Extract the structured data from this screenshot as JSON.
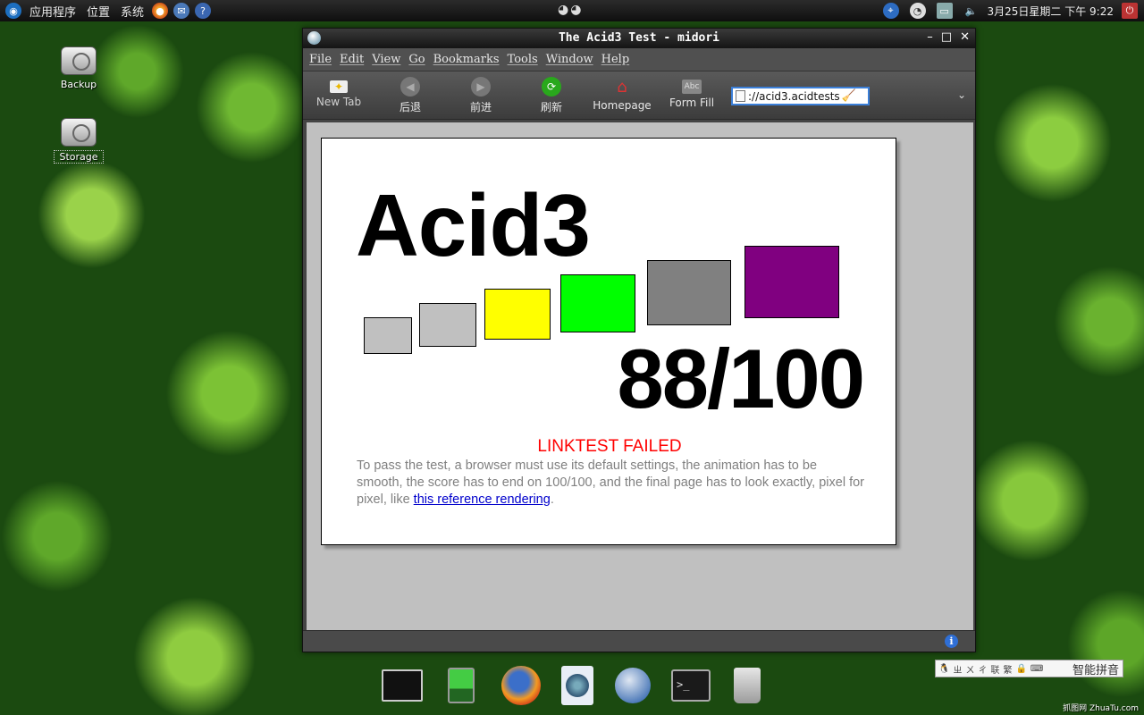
{
  "top_panel": {
    "applications": "应用程序",
    "places": "位置",
    "system": "系统",
    "clock": "3月25日星期二 下午 9:22",
    "eyes": "◕◕"
  },
  "desktop": {
    "icons": [
      {
        "label": "Backup"
      },
      {
        "label": "Storage"
      }
    ]
  },
  "window": {
    "title": "The Acid3 Test - midori",
    "controls": {
      "minimize": "–",
      "maximize": "□",
      "close": "✕"
    },
    "menu": [
      "File",
      "Edit",
      "View",
      "Go",
      "Bookmarks",
      "Tools",
      "Window",
      "Help"
    ],
    "toolbar": {
      "new_tab": "New Tab",
      "back": "后退",
      "forward": "前进",
      "refresh": "刷新",
      "homepage": "Homepage",
      "form_fill": "Form Fill",
      "url": "://acid3.acidtests",
      "overflow": "⌄"
    }
  },
  "page": {
    "title": "Acid3",
    "score": "88/100",
    "status": "LINKTEST FAILED",
    "instructions_text": "To pass the test, a browser must use its default settings, the animation has to be smooth, the score has to end on 100/100, and the final page has to look exactly, pixel for pixel, like ",
    "link_text": "this reference rendering",
    "instructions_end": ".",
    "bucket_colors": [
      "#c0c0c0",
      "#c0c0c0",
      "#ffff00",
      "#00ff00",
      "#808080",
      "#800080"
    ]
  },
  "ime": {
    "items": [
      "ㄓ",
      "ㄨ",
      "ㄔ",
      "联",
      "繁",
      "🔒",
      "⌨"
    ],
    "name": "智能拼音"
  },
  "watermark": "抓图网 ZhuaTu.com"
}
